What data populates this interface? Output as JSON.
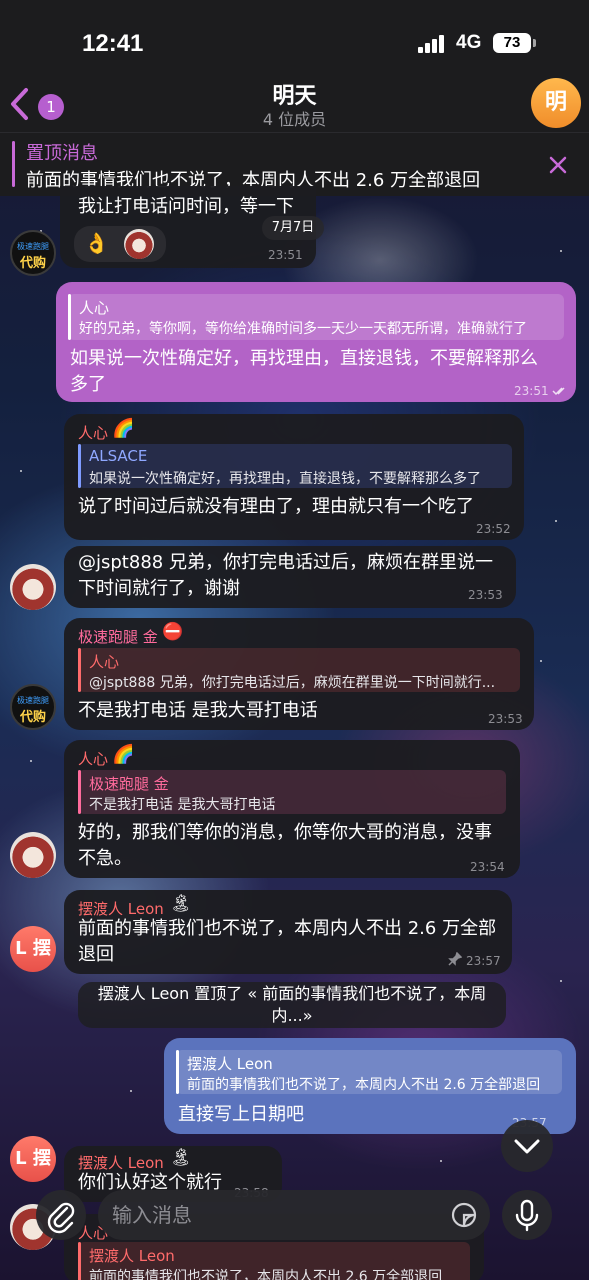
{
  "status_bar": {
    "time": "12:41",
    "network": "4G",
    "battery": "73"
  },
  "header": {
    "title": "明天",
    "subtitle": "4 位成员",
    "back_badge": "1",
    "avatar_letter": "明"
  },
  "pinned": {
    "title": "置顶消息",
    "text": "前面的事情我们也不说了，本周内人不出 2.6 万全部退回"
  },
  "date_divider": "7月7日",
  "messages": [
    {
      "text": "我让打电话问时间，等一下",
      "time": "23:51",
      "reactions": [
        "👌"
      ]
    },
    {
      "reply_name": "人心",
      "reply_text": "好的兄弟，等你啊，等你给准确时间多一天少一天都无所谓，准确就行了",
      "text_line1": "如果说一次性确定好，再找理由，直接退钱，不要解释那么",
      "text_line2": "多了",
      "time": "23:51"
    },
    {
      "sender": "人心",
      "sender_emoji": "🌈",
      "reply_name": "ALSACE",
      "reply_text": "如果说一次性确定好，再找理由，直接退钱，不要解释那么多了",
      "text": "说了时间过后就没有理由了，理由就只有一个吃了",
      "time": "23:52"
    },
    {
      "text_line1": "@jspt888 兄弟，你打完电话过后，麻烦在群里说一",
      "text_line2": "下时间就行了，谢谢",
      "time": "23:53"
    },
    {
      "sender": "极速跑腿 金",
      "sender_emoji": "⛔",
      "reply_name": "人心",
      "reply_text": "@jspt888 兄弟，你打完电话过后，麻烦在群里说一下时间就行...",
      "text": "不是我打电话 是我大哥打电话",
      "time": "23:53"
    },
    {
      "sender": "人心",
      "sender_emoji": "🌈",
      "reply_name": "极速跑腿 金",
      "reply_text": "不是我打电话 是我大哥打电话",
      "text_line1": "好的，那我们等你的消息，你等你大哥的消息，没事",
      "text_line2": "不急。",
      "time": "23:54"
    },
    {
      "sender": "摆渡人 Leon",
      "sender_emoji": "🏝",
      "text_line1": "前面的事情我们也不说了，本周内人不出 2.6 万全部",
      "text_line2": "退回",
      "time": "23:57"
    },
    {
      "service_line1": "摆渡人 Leon 置顶了 « 前面的事情我们也不说了，本周",
      "service_line2": "内...»"
    },
    {
      "reply_name": "摆渡人 Leon",
      "reply_text": "前面的事情我们也不说了，本周内人不出 2.6 万全部退回",
      "text": "直接写上日期吧",
      "time": "23:57"
    },
    {
      "sender": "摆渡人 Leon",
      "sender_emoji": "🏝",
      "text": "你们认好这个就行",
      "time": "23:58"
    },
    {
      "sender": "人心",
      "reply_name": "摆渡人 Leon",
      "reply_text": "前面的事情我们也不说了，本周内人不出 2.6 万全部退回"
    }
  ],
  "avatars": {
    "logo_top": "极速跑腿",
    "logo_bottom": "代购",
    "leon_letter": "L 摆"
  },
  "input": {
    "placeholder": "输入消息"
  },
  "colors": {
    "accent": "#c86ad8",
    "outgoing_purple": "#b363c7",
    "outgoing_blue": "#5b73bd",
    "link": "#6fa8ff"
  }
}
